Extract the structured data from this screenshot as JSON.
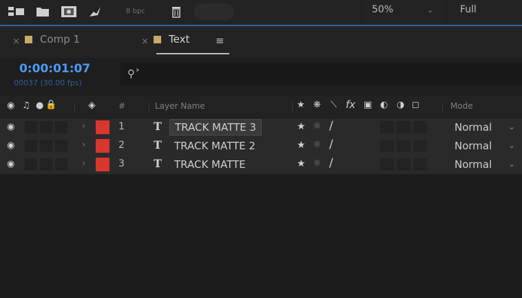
{
  "toolbar": {
    "bpc": "8 bpc",
    "zoom": "50%",
    "resolution": "Full",
    "icons": [
      "flowchart-icon",
      "folder-icon",
      "render-icon",
      "pen-icon",
      "trash-icon"
    ]
  },
  "tabs": [
    {
      "label": "Comp 1",
      "active": false,
      "color": "#c8a96a"
    },
    {
      "label": "Text",
      "active": true,
      "color": "#c8a96a"
    }
  ],
  "time": {
    "timecode": "0:00:01:07",
    "frames": "00037 (30.00 fps)"
  },
  "header": {
    "hash": "#",
    "layer_name": "Layer Name",
    "mode": "Mode"
  },
  "layers": [
    {
      "index": "1",
      "name": "TRACK MATTE 3",
      "mode": "Normal",
      "selected": true,
      "label_color": "#d9362e"
    },
    {
      "index": "2",
      "name": "TRACK MATTE 2",
      "mode": "Normal",
      "selected": false,
      "label_color": "#d9362e"
    },
    {
      "index": "3",
      "name": "TRACK MATTE",
      "mode": "Normal",
      "selected": false,
      "label_color": "#d9362e"
    }
  ]
}
